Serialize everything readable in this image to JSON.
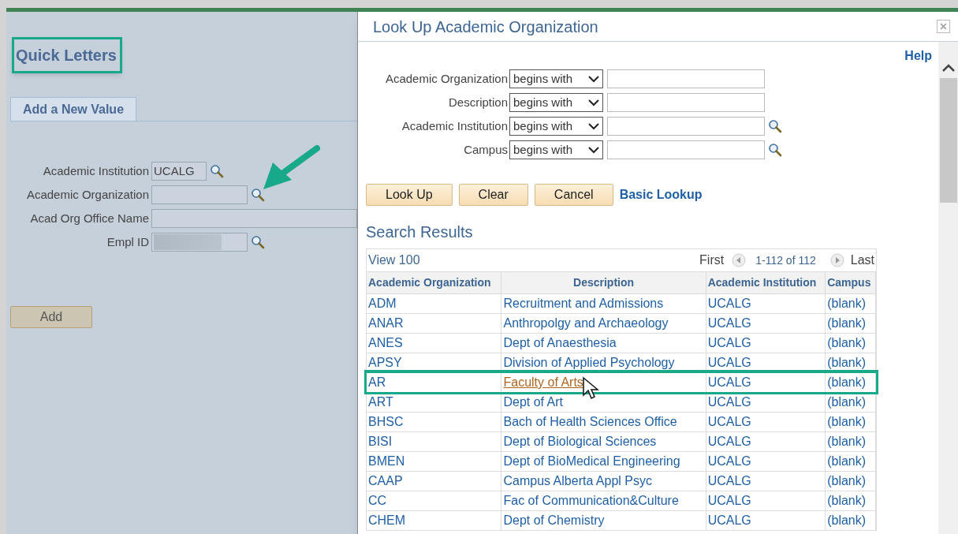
{
  "page": {
    "title": "Quick Letters",
    "tabs": [
      {
        "label": "Add a New Value",
        "selected": true
      }
    ],
    "fields": [
      {
        "label": "Academic Institution",
        "value": "UCALG",
        "kind": "short",
        "lookup": true,
        "redacted": false
      },
      {
        "label": "Academic Organization",
        "kind": "medium",
        "lookup": true,
        "redacted": false
      },
      {
        "label": "Acad Org Office Name",
        "kind": "long",
        "lookup": false,
        "redacted": false
      },
      {
        "label": "Empl ID",
        "kind": "medium",
        "lookup": true,
        "redacted": true
      }
    ],
    "add_button": "Add"
  },
  "dialog": {
    "title": "Look Up Academic Organization",
    "help": "Help",
    "criteria": [
      {
        "label": "Academic Organization",
        "operator": "begins with",
        "lookup": false
      },
      {
        "label": "Description",
        "operator": "begins with",
        "lookup": false
      },
      {
        "label": "Academic Institution",
        "operator": "begins with",
        "lookup": true
      },
      {
        "label": "Campus",
        "operator": "begins with",
        "lookup": true
      }
    ],
    "buttons": [
      "Look Up",
      "Clear",
      "Cancel"
    ],
    "basic_lookup": "Basic Lookup",
    "results_title": "Search Results",
    "view_all": "View 100",
    "first": "First",
    "range": "1-112 of 112",
    "last": "Last",
    "columns": [
      "Academic Organization",
      "Description",
      "Academic Institution",
      "Campus"
    ],
    "rows": [
      {
        "cells": [
          "ADM",
          "Recruitment and Admissions",
          "UCALG",
          "(blank)"
        ],
        "selected": false
      },
      {
        "cells": [
          "ANAR",
          "Anthropolgy and Archaeology",
          "UCALG",
          "(blank)"
        ],
        "selected": false
      },
      {
        "cells": [
          "ANES",
          "Dept of Anaesthesia",
          "UCALG",
          "(blank)"
        ],
        "selected": false
      },
      {
        "cells": [
          "APSY",
          "Division of Applied Psychology",
          "UCALG",
          "(blank)"
        ],
        "selected": false
      },
      {
        "cells": [
          "AR",
          "Faculty of Arts",
          "UCALG",
          "(blank)"
        ],
        "selected": true
      },
      {
        "cells": [
          "ART",
          "Dept of Art",
          "UCALG",
          "(blank)"
        ],
        "selected": false
      },
      {
        "cells": [
          "BHSC",
          "Bach of Health Sciences Office",
          "UCALG",
          "(blank)"
        ],
        "selected": false
      },
      {
        "cells": [
          "BISI",
          "Dept of Biological Sciences",
          "UCALG",
          "(blank)"
        ],
        "selected": false
      },
      {
        "cells": [
          "BMEN",
          "Dept of BioMedical Engineering",
          "UCALG",
          "(blank)"
        ],
        "selected": false
      },
      {
        "cells": [
          "CAAP",
          "Campus Alberta Appl Psyc",
          "UCALG",
          "(blank)"
        ],
        "selected": false
      },
      {
        "cells": [
          "CC",
          "Fac of Communication&Culture",
          "UCALG",
          "(blank)"
        ],
        "selected": false
      },
      {
        "cells": [
          "CHEM",
          "Dept of Chemistry",
          "UCALG",
          "(blank)"
        ],
        "selected": false
      }
    ]
  }
}
